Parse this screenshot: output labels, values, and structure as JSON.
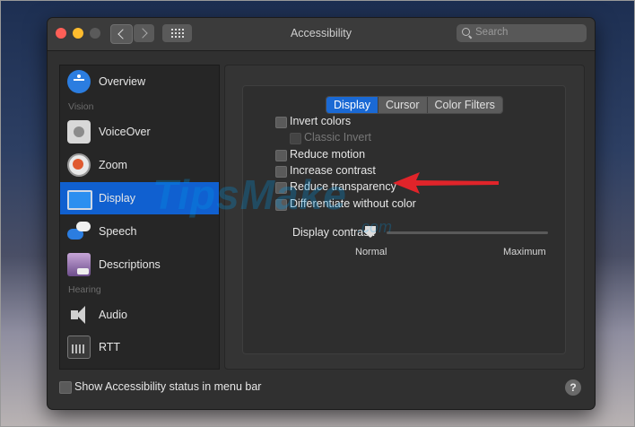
{
  "window": {
    "title": "Accessibility"
  },
  "search": {
    "placeholder": "Search"
  },
  "sidebar": {
    "items": [
      {
        "label": "Overview"
      },
      {
        "label": "VoiceOver"
      },
      {
        "label": "Zoom"
      },
      {
        "label": "Display"
      },
      {
        "label": "Speech"
      },
      {
        "label": "Descriptions"
      },
      {
        "label": "Audio"
      },
      {
        "label": "RTT"
      }
    ],
    "headers": {
      "vision": "Vision",
      "hearing": "Hearing"
    },
    "selected": "Display"
  },
  "tabs": [
    {
      "label": "Display",
      "active": true
    },
    {
      "label": "Cursor",
      "active": false
    },
    {
      "label": "Color Filters",
      "active": false
    }
  ],
  "options": [
    {
      "label": "Invert colors",
      "checked": false,
      "enabled": true
    },
    {
      "label": "Classic Invert",
      "checked": false,
      "enabled": false
    },
    {
      "label": "Reduce motion",
      "checked": false,
      "enabled": true
    },
    {
      "label": "Increase contrast",
      "checked": false,
      "enabled": true
    },
    {
      "label": "Reduce transparency",
      "checked": false,
      "enabled": true
    },
    {
      "label": "Differentiate without color",
      "checked": false,
      "enabled": true
    }
  ],
  "display_contrast": {
    "label": "Display contrast:",
    "min_label": "Normal",
    "max_label": "Maximum",
    "value": 0
  },
  "footer": {
    "status_label": "Show Accessibility status in menu bar",
    "status_checked": false,
    "help": "?"
  },
  "watermark": {
    "text": "TipsMake",
    "suffix": ".com"
  },
  "colors": {
    "accent": "#1a69d4",
    "arrow": "#e0242a"
  }
}
